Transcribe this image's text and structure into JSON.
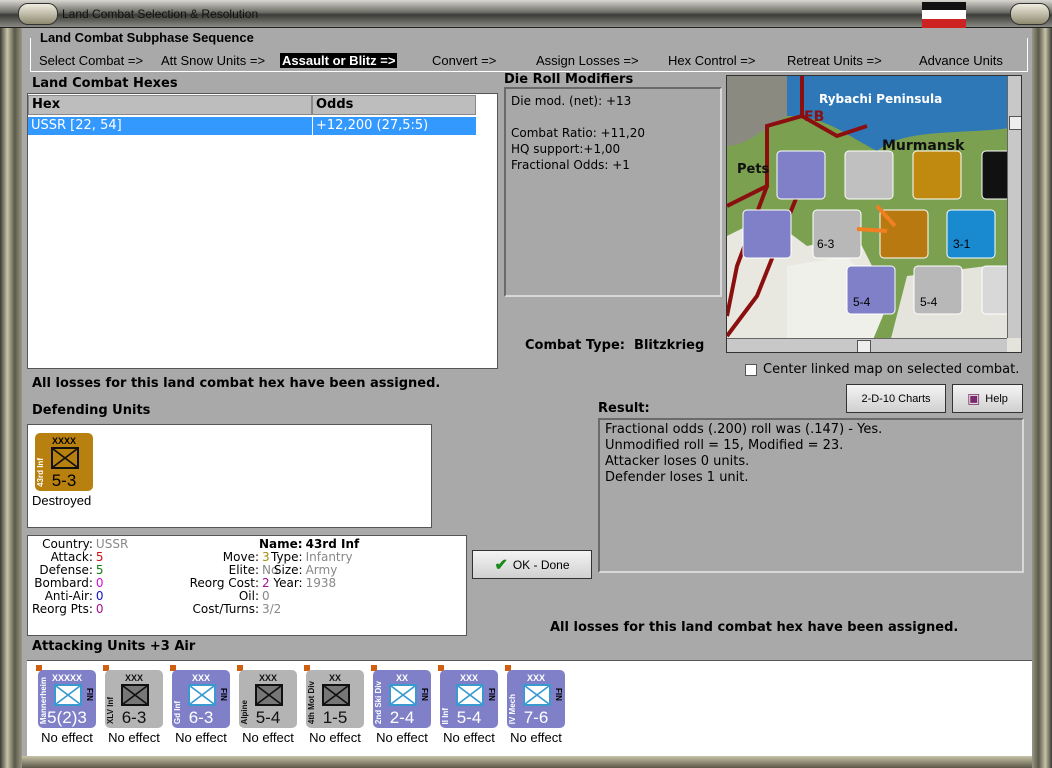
{
  "window": {
    "title": "Land Combat Selection & Resolution"
  },
  "sequence": {
    "title": "Land Combat Subphase Sequence",
    "steps": [
      "Select Combat =>",
      "Att Snow Units =>",
      "Assault or Blitz =>",
      "Convert =>",
      "Assign Losses =>",
      "Hex Control =>",
      "Retreat Units =>",
      "Advance Units"
    ],
    "active_index": 2
  },
  "hexes": {
    "title": "Land Combat Hexes",
    "columns": [
      "Hex",
      "Odds"
    ],
    "rows": [
      {
        "hex": "USSR [22, 54]",
        "odds": "+12,200 (27,5:5)"
      }
    ]
  },
  "die_roll": {
    "title": "Die Roll Modifiers",
    "lines": [
      "Die mod. (net): +13",
      "",
      "Combat Ratio: +11,20",
      "HQ support:+1,00",
      "Fractional Odds: +1"
    ]
  },
  "map": {
    "labels": [
      "Rybachi Peninsula",
      "FB",
      "Murmansk",
      "Pets"
    ],
    "scroll_pct": {
      "vertical": 15,
      "horizontal": 45
    }
  },
  "combat_type": {
    "label": "Combat Type:",
    "value": "Blitzkrieg"
  },
  "center_map": {
    "label": "Center linked map on selected combat.",
    "checked": false
  },
  "losses_msg_top": "All losses for this land combat hex have been assigned.",
  "losses_msg_bottom": "All losses for this land combat hex have been assigned.",
  "buttons": {
    "charts": "2-D-10 Charts",
    "help": "Help",
    "ok": "OK - Done"
  },
  "defending": {
    "title": "Defending Units",
    "units": [
      {
        "size": "XXXX",
        "name": "43rd Inf",
        "strength": "5-3",
        "result": "Destroyed",
        "color": "#b8800e"
      }
    ]
  },
  "result": {
    "title": "Result:",
    "lines": [
      "Fractional odds (.200) roll was (.147)  - Yes.",
      "Unmodified roll = 15, Modified = 23.",
      "Attacker loses 0 units.",
      "Defender loses 1 unit."
    ]
  },
  "unit_info": {
    "country": {
      "label": "Country:",
      "value": "USSR"
    },
    "attack": {
      "label": "Attack:",
      "value": "5"
    },
    "defense": {
      "label": "Defense:",
      "value": "5"
    },
    "bombard": {
      "label": "Bombard:",
      "value": "0"
    },
    "anti_air": {
      "label": "Anti-Air:",
      "value": "0"
    },
    "reorg_pts": {
      "label": "Reorg Pts:",
      "value": "0"
    },
    "move": {
      "label": "Move:",
      "value": "3"
    },
    "elite": {
      "label": "Elite:",
      "value": "No"
    },
    "reorg_cost": {
      "label": "Reorg Cost:",
      "value": "2"
    },
    "oil": {
      "label": "Oil:",
      "value": "0"
    },
    "cost_turns": {
      "label": "Cost/Turns:",
      "value": "3/2"
    },
    "name": {
      "label": "Name:",
      "value": "43rd Inf"
    },
    "type": {
      "label": "Type:",
      "value": "Infantry"
    },
    "size": {
      "label": "Size:",
      "value": "Army"
    },
    "year": {
      "label": "Year:",
      "value": "1938"
    }
  },
  "attacking": {
    "title": "Attacking Units +3 Air",
    "units": [
      {
        "size": "XXXXX",
        "name": "Mannerheim",
        "nation": "FIN",
        "strength": "5(2)3",
        "result": "No effect",
        "color": "#8080c8"
      },
      {
        "size": "XXX",
        "name": "XLV Inf",
        "nation": "",
        "strength": "6-3",
        "result": "No effect",
        "color": "#b4b4b4"
      },
      {
        "size": "XXX",
        "name": "Gd Inf",
        "nation": "FIN",
        "strength": "6-3",
        "result": "No effect",
        "color": "#8080c8"
      },
      {
        "size": "XXX",
        "name": "Alpine",
        "nation": "",
        "strength": "5-4",
        "result": "No effect",
        "color": "#b4b4b4"
      },
      {
        "size": "XX",
        "name": "4th Mot Div",
        "nation": "",
        "strength": "1-5",
        "result": "No effect",
        "color": "#b4b4b4"
      },
      {
        "size": "XX",
        "name": "2nd Ski Div",
        "nation": "FIN",
        "strength": "2-4",
        "result": "No effect",
        "color": "#8080c8"
      },
      {
        "size": "XXX",
        "name": "II Inf",
        "nation": "FIN",
        "strength": "5-4",
        "result": "No effect",
        "color": "#8080c8"
      },
      {
        "size": "XXX",
        "name": "IV Mech",
        "nation": "FIN",
        "strength": "7-6",
        "result": "No effect",
        "color": "#8080c8"
      }
    ]
  }
}
